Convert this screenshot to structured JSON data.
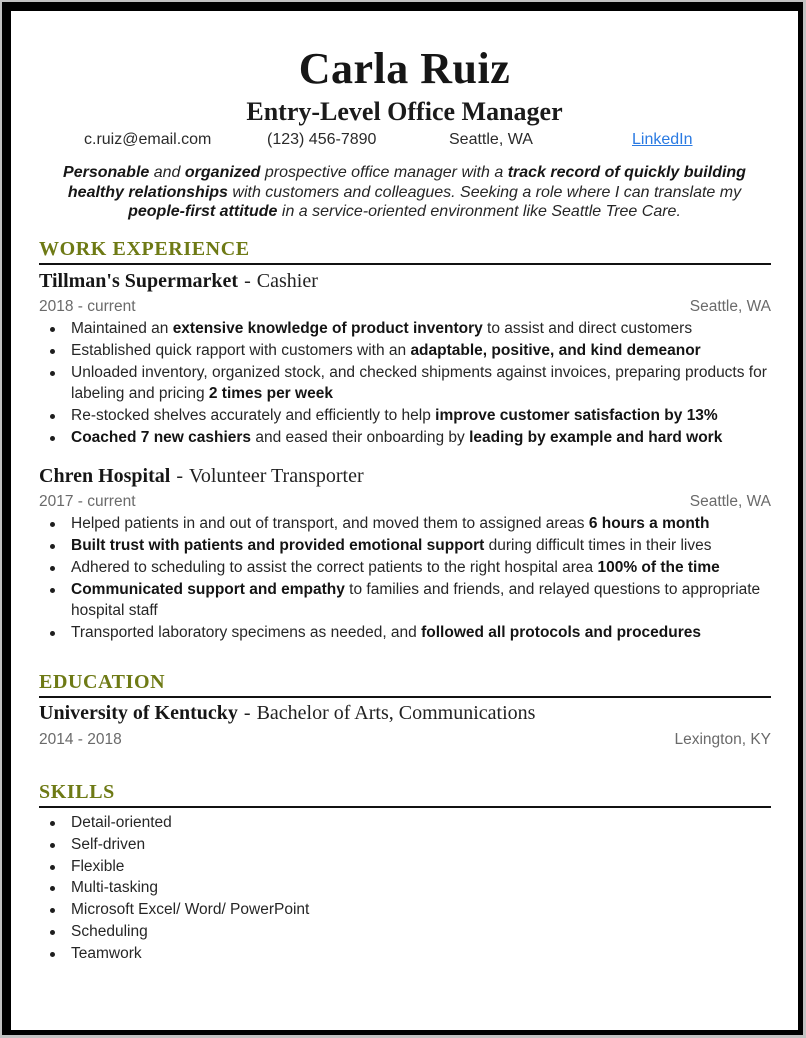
{
  "header": {
    "name": "Carla Ruiz",
    "title": "Entry-Level Office Manager",
    "contact": {
      "email": "c.ruiz@email.com",
      "phone": "(123) 456-7890",
      "location": "Seattle, WA",
      "linkedin_label": "LinkedIn"
    },
    "summary": [
      {
        "t": "Personable",
        "b": true
      },
      {
        "t": " and ",
        "b": false
      },
      {
        "t": "organized",
        "b": true
      },
      {
        "t": " prospective office manager with a ",
        "b": false
      },
      {
        "t": "track record of quickly building healthy relationships",
        "b": true
      },
      {
        "t": " with customers and colleagues. Seeking a role where I can translate my ",
        "b": false
      },
      {
        "t": "people-first attitude",
        "b": true
      },
      {
        "t": " in a service-oriented environment like Seattle Tree Care.",
        "b": false
      }
    ]
  },
  "colors": {
    "section_heading": "#6e7a15",
    "link": "#2a7ae2",
    "meta_text": "#6a6a6a"
  },
  "sections": {
    "work_experience": {
      "heading": "WORK EXPERIENCE",
      "jobs": [
        {
          "organization": "Tillman's Supermarket",
          "separator": "-",
          "role": "Cashier",
          "dates": "2018 - current",
          "location": "Seattle, WA",
          "bullets": [
            [
              {
                "t": "Maintained an ",
                "b": false
              },
              {
                "t": "extensive knowledge of product inventory",
                "b": true
              },
              {
                "t": " to assist and direct customers",
                "b": false
              }
            ],
            [
              {
                "t": "Established quick rapport with customers with an ",
                "b": false
              },
              {
                "t": "adaptable, positive, and kind demeanor",
                "b": true
              }
            ],
            [
              {
                "t": "Unloaded inventory, organized stock, and checked shipments against invoices, preparing products for labeling and pricing ",
                "b": false
              },
              {
                "t": "2 times per week",
                "b": true
              }
            ],
            [
              {
                "t": "Re-stocked shelves accurately and efficiently to help ",
                "b": false
              },
              {
                "t": "improve customer satisfaction by 13%",
                "b": true
              }
            ],
            [
              {
                "t": "Coached 7 new cashiers",
                "b": true
              },
              {
                "t": " and eased their onboarding by ",
                "b": false
              },
              {
                "t": "leading by example and hard work",
                "b": true
              }
            ]
          ]
        },
        {
          "organization": "Chren Hospital",
          "separator": "-",
          "role": "Volunteer Transporter",
          "dates": "2017 - current",
          "location": "Seattle, WA",
          "bullets": [
            [
              {
                "t": "Helped patients in and out of transport, and moved them to assigned areas ",
                "b": false
              },
              {
                "t": "6 hours a month",
                "b": true
              }
            ],
            [
              {
                "t": "Built trust with patients and provided emotional support",
                "b": true
              },
              {
                "t": " during difficult times in their lives",
                "b": false
              }
            ],
            [
              {
                "t": "Adhered to scheduling to assist the correct patients to the right hospital area ",
                "b": false
              },
              {
                "t": "100% of the time",
                "b": true
              }
            ],
            [
              {
                "t": "Communicated support and empathy",
                "b": true
              },
              {
                "t": " to families and friends, and relayed questions to appropriate hospital staff",
                "b": false
              }
            ],
            [
              {
                "t": "Transported laboratory specimens as needed, and ",
                "b": false
              },
              {
                "t": "followed all protocols and procedures",
                "b": true
              }
            ]
          ]
        }
      ]
    },
    "education": {
      "heading": "EDUCATION",
      "school": "University of Kentucky",
      "separator": "-",
      "degree": "Bachelor of Arts, Communications",
      "dates": "2014 - 2018",
      "location": "Lexington, KY"
    },
    "skills": {
      "heading": "SKILLS",
      "items": [
        "Detail-oriented",
        "Self-driven",
        "Flexible",
        "Multi-tasking",
        "Microsoft Excel/ Word/ PowerPoint",
        "Scheduling",
        "Teamwork"
      ]
    }
  }
}
